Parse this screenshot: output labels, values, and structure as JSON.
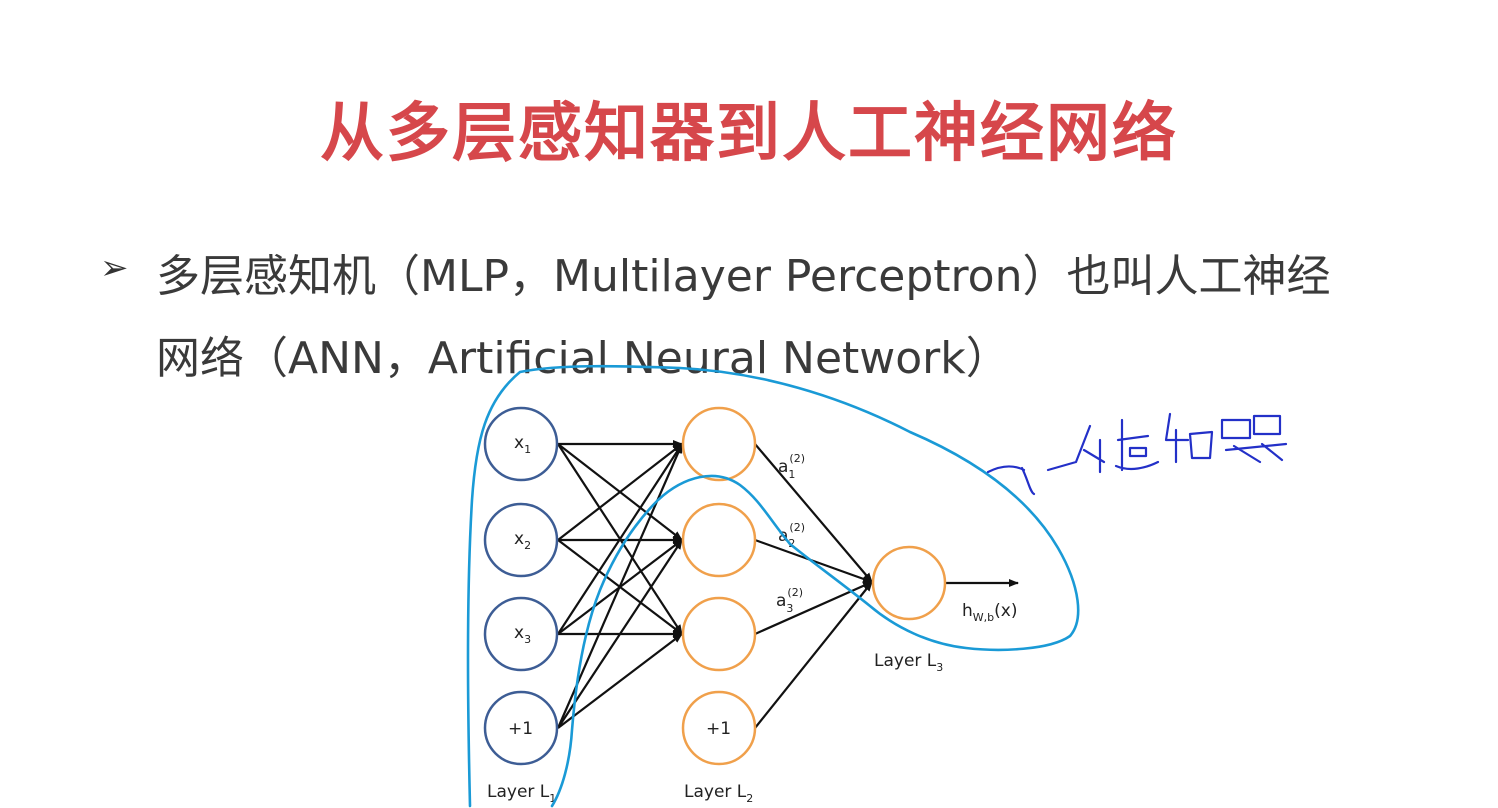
{
  "slide": {
    "title": "从多层感知器到人工神经网络",
    "bullet_line1": "多层感知机（MLP，Multilayer  Perceptron）也叫人工神经",
    "bullet_line2": "网络（ANN，Artificial Neural Network）"
  },
  "diagram": {
    "input_nodes": [
      {
        "label": "x",
        "sub": "1"
      },
      {
        "label": "x",
        "sub": "2"
      },
      {
        "label": "x",
        "sub": "3"
      },
      {
        "label": "+1",
        "sub": ""
      }
    ],
    "hidden_bias_label": "+1",
    "activation_labels": [
      {
        "label": "a",
        "sub": "1",
        "sup": "(2)"
      },
      {
        "label": "a",
        "sub": "2",
        "sup": "(2)"
      },
      {
        "label": "a",
        "sub": "3",
        "sup": "(2)"
      }
    ],
    "output_label": "h",
    "output_sub": "W,b",
    "output_arg": "(x)",
    "layer_labels": [
      {
        "label": "Layer L",
        "sub": "1"
      },
      {
        "label": "Layer L",
        "sub": "2"
      },
      {
        "label": "Layer L",
        "sub": "3"
      }
    ]
  },
  "annotation": {
    "handwritten_note": "一个感知器",
    "ink_color": "#1a9ad6",
    "note_color": "#2330c8"
  }
}
